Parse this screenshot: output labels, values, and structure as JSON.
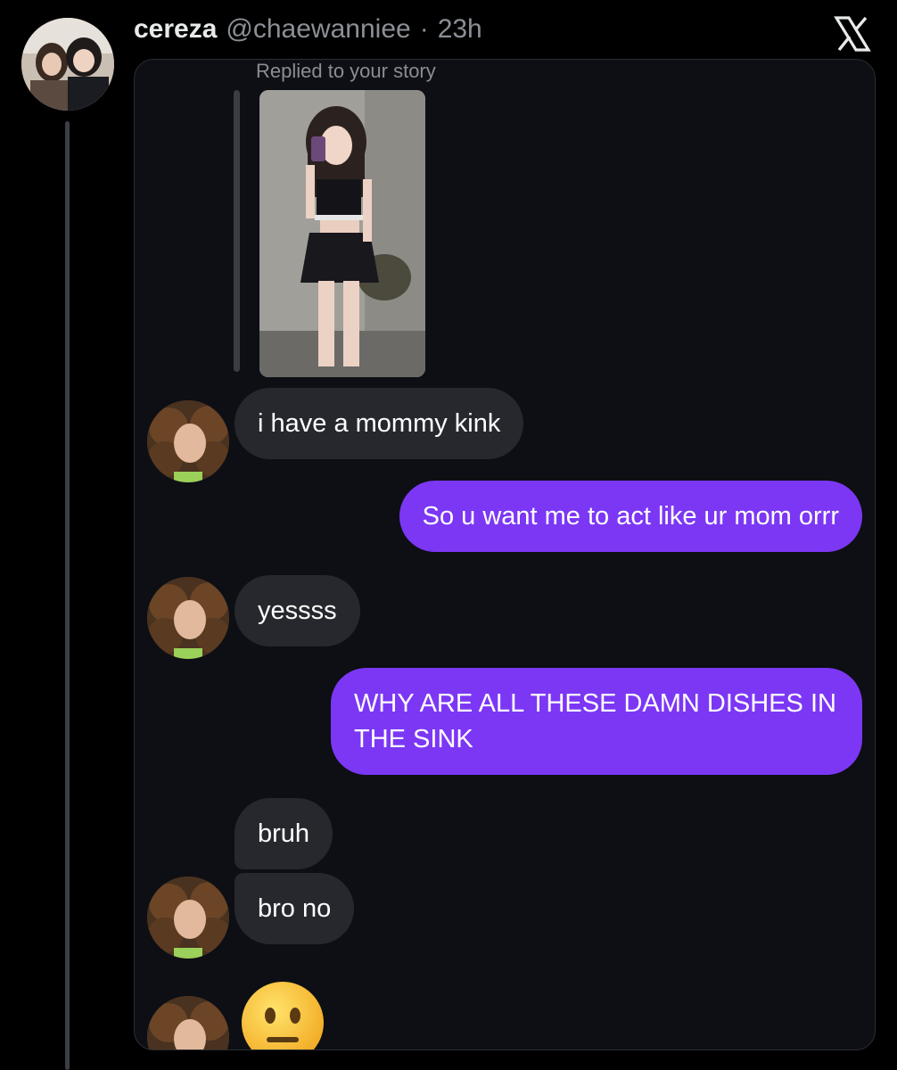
{
  "tweet": {
    "display_name": "cereza",
    "handle": "@chaewanniee",
    "separator": "·",
    "time": "23h"
  },
  "dm": {
    "replied_label": "Replied to your story",
    "messages": [
      {
        "from": "them",
        "text": "i have a mommy kink"
      },
      {
        "from": "me",
        "text": "So u want me to act like ur mom orrr"
      },
      {
        "from": "them",
        "text": "yessss"
      },
      {
        "from": "me",
        "text": "WHY ARE ALL THESE DAMN DISHES IN THE SINK"
      },
      {
        "from": "them",
        "text": "bruh"
      },
      {
        "from": "them",
        "text": "bro no"
      },
      {
        "from": "them",
        "emoji": "neutral-face-emoji"
      }
    ]
  },
  "colors": {
    "outgoing_bubble": "#7c37f5",
    "incoming_bubble": "#26282e",
    "background": "#000000"
  }
}
